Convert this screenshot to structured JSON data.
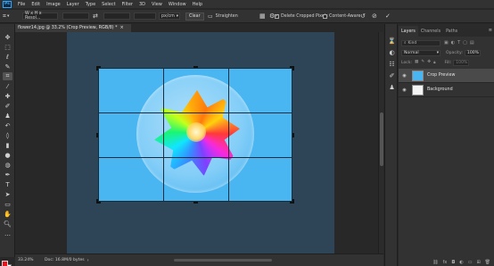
{
  "app": {
    "logo": "Ps"
  },
  "menu": [
    "File",
    "Edit",
    "Image",
    "Layer",
    "Type",
    "Select",
    "Filter",
    "3D",
    "View",
    "Window",
    "Help"
  ],
  "options": {
    "ratio_value": "W x H x Resol...",
    "unit_value": "px/cm",
    "clear_label": "Clear",
    "straighten_label": "Straighten",
    "delete_cropped_label": "Delete Cropped Pixels",
    "delete_cropped_checked": true,
    "content_aware_label": "Content-Aware",
    "content_aware_checked": false
  },
  "document": {
    "tab_title": "flower14.jpg @ 33.2% (Crop Preview, RGB/8) *",
    "close": "×"
  },
  "status": {
    "zoom": "33.24%",
    "doc_size": "Doc: 16.8M/0 bytes",
    "arrow": "›"
  },
  "layers_panel": {
    "tabs": [
      "Layers",
      "Channels",
      "Paths"
    ],
    "kind_placeholder": "Kind",
    "blend_mode": "Normal",
    "opacity_label": "Opacity:",
    "opacity_value": "100%",
    "lock_label": "Lock:",
    "fill_label": "Fill:",
    "fill_value": "100%",
    "layers": [
      {
        "name": "Crop Preview",
        "selected": true
      },
      {
        "name": "Background",
        "selected": false
      }
    ]
  },
  "colors": {
    "foreground": "#e8141d",
    "background": "#ffffff",
    "canvas_bg": "#49b6f1",
    "pasteboard": "#2e4558"
  },
  "icons": {
    "tools": [
      "move-icon",
      "marquee-icon",
      "lasso-icon",
      "quick-select-icon",
      "crop-icon",
      "eyedropper-icon",
      "healing-icon",
      "brush-icon",
      "stamp-icon",
      "history-brush-icon",
      "eraser-icon",
      "gradient-icon",
      "blur-icon",
      "dodge-icon",
      "pen-icon",
      "type-icon",
      "path-select-icon",
      "rectangle-icon",
      "hand-icon",
      "zoom-icon"
    ]
  }
}
